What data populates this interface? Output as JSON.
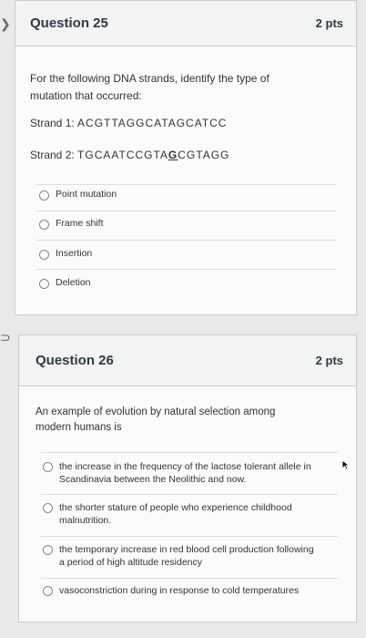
{
  "q25": {
    "title": "Question 25",
    "points": "2 pts",
    "prompt_line1": "For the following DNA strands, identify the type of",
    "prompt_line2": "mutation that occurred:",
    "strand1_label": "Strand 1: ",
    "strand1_seq": "ACGTTAGGCATAGCATCC",
    "strand2_label": "Strand 2: ",
    "strand2_seq_a": "TGCAATCCGTA",
    "strand2_seq_b": "G",
    "strand2_seq_c": "CGTAGG",
    "options": [
      "Point mutation",
      "Frame shift",
      "Insertion",
      "Deletion"
    ]
  },
  "q26": {
    "title": "Question 26",
    "points": "2 pts",
    "prompt_line1": "An example of evolution by natural selection among",
    "prompt_line2": "modern humans is",
    "options": [
      [
        "the increase in the frequency of the lactose tolerant allele in",
        "Scandinavia between the Neolithic and now."
      ],
      [
        "the shorter stature of people who experience childhood",
        "malnutrition."
      ],
      [
        "the temporary increase in red blood cell production following",
        "a period of high altitude residency"
      ],
      [
        "vasoconstriction during in response to cold temperatures"
      ]
    ]
  },
  "colors": {
    "page_bg": "#e9e9e7",
    "card_header": "#f2f3f3",
    "text": "#2d3b45"
  }
}
